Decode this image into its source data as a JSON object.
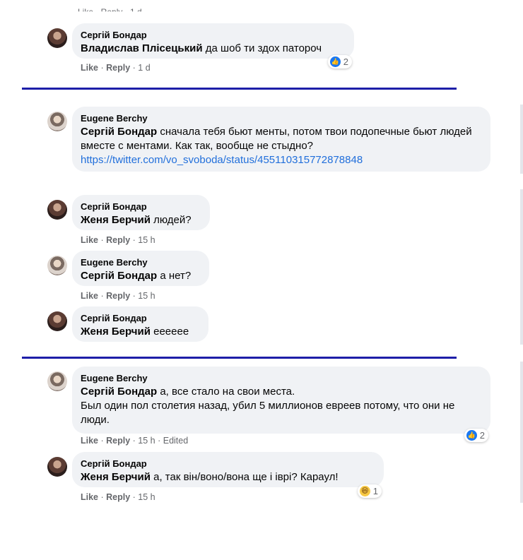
{
  "top_cutoff": "Like · Reply · 1 d",
  "comments": [
    {
      "author": "Сергій Бондар",
      "mention": "Владислав Плісецький",
      "text": " да шоб ти здох патороч",
      "like": "Like",
      "reply": "Reply",
      "time": "1 d",
      "reaction_count": "2"
    },
    {
      "author": "Eugene Berchy",
      "mention": "Сергій Бондар",
      "text": " сначала тебя бьют менты, потом твои подопечные бьют людей вместе с ментами. Как так, вообще не стыдно?",
      "link": "https://twitter.com/vo_svoboda/status/455110315772878848"
    },
    {
      "author": "Сергій Бондар",
      "mention": "Женя Берчий",
      "text": " людей?",
      "like": "Like",
      "reply": "Reply",
      "time": "15 h"
    },
    {
      "author": "Eugene Berchy",
      "mention": "Сергій Бондар",
      "text": " а нет?",
      "like": "Like",
      "reply": "Reply",
      "time": "15 h"
    },
    {
      "author": "Сергій Бондар",
      "mention": "Женя Берчий",
      "text": " ееееее"
    },
    {
      "author": "Eugene Berchy",
      "mention": "Сергій Бондар",
      "text": " а, все стало на свои места.",
      "text2": "Был один пол столетия назад, убил 5 миллионов евреев потому, что они не люди.",
      "like": "Like",
      "reply": "Reply",
      "time": "15 h",
      "edited": "Edited",
      "reaction_count": "2"
    },
    {
      "author": "Сергій Бондар",
      "mention": "Женя Берчий",
      "text": " а, так він/воно/вона ще і іврі? Караул!",
      "like": "Like",
      "reply": "Reply",
      "time": "15 h",
      "reaction_count": "1"
    }
  ],
  "colors": {
    "separator": "#1d1ea8",
    "bubble": "#f0f2f5",
    "link": "#216fdb",
    "meta": "#65676b"
  },
  "icons": {
    "like": "like-reaction-icon",
    "haha": "haha-reaction-icon"
  }
}
